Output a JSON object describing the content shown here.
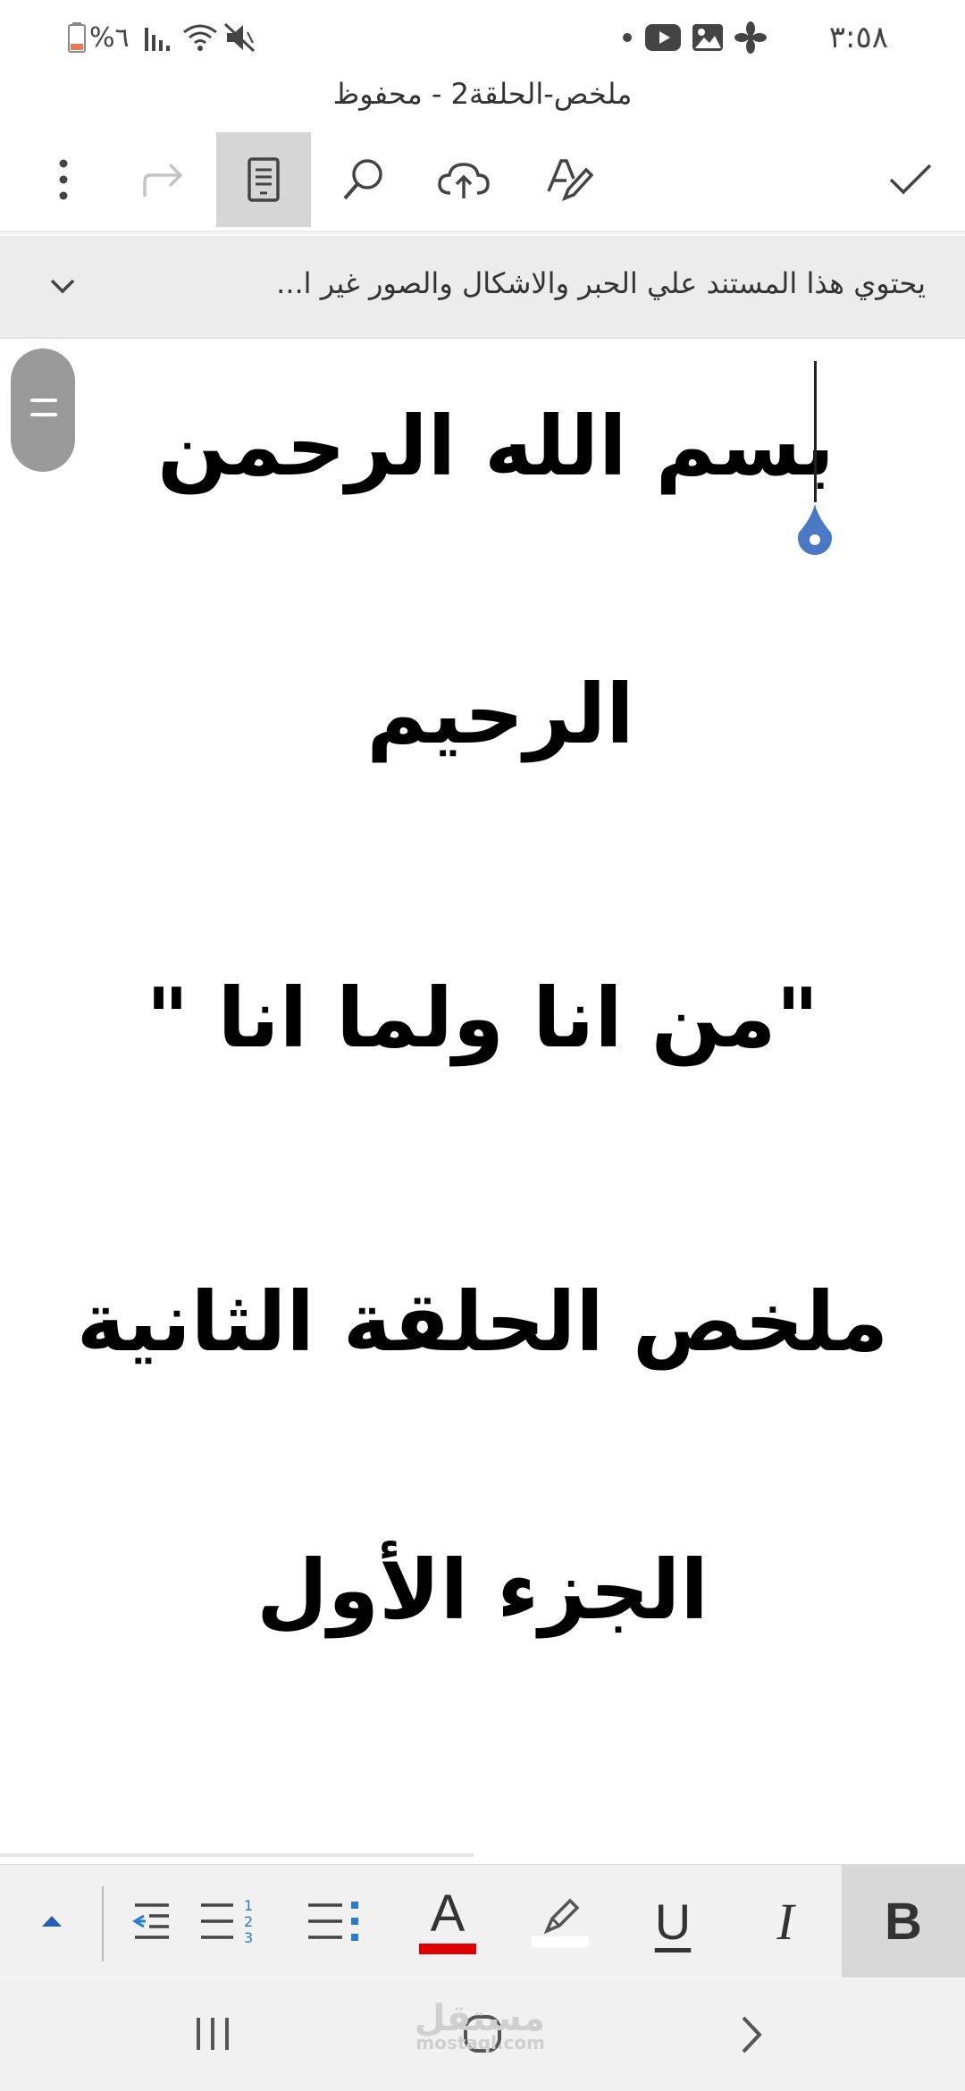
{
  "status_bar": {
    "time": "٣:٥٨",
    "battery": "%٦",
    "icons": [
      "dot-icon",
      "youtube-icon",
      "gallery-icon",
      "fan-icon",
      "mute-icon",
      "wifi-icon",
      "signal-icon",
      "battery-icon"
    ]
  },
  "document": {
    "title": "ملخص-الحلقة2 - محفوظ"
  },
  "toolbar": {
    "buttons": [
      "more-options-icon",
      "redo-icon",
      "mobile-view-icon",
      "search-icon",
      "save-cloud-icon",
      "draw-pen-icon",
      "done-check-icon"
    ],
    "active": "mobile-view-icon"
  },
  "notice": {
    "text": "يحتوي هذا المستند علي الحبر والاشكال والصور غير ا..."
  },
  "content": {
    "lines": [
      "بسم الله الرحمن",
      "الرحيم",
      "\"من انا ولما انا \"",
      "ملخص الحلقة الثانية",
      "الجزء الأول"
    ]
  },
  "format_bar": {
    "bold": "B",
    "italic": "I",
    "underline": "U",
    "font_color_letter": "A",
    "font_color": "#e00000",
    "highlight_color": "#ffffff",
    "list_numbers": "123"
  },
  "nav_bar": {
    "buttons": [
      "recent-apps-icon",
      "home-icon",
      "back-icon"
    ]
  },
  "watermark": {
    "text": "مستقل",
    "sub": "mostaql.com"
  },
  "colors": {
    "accent_blue": "#4a78c4",
    "toolbar_active": "#d6d6d6"
  }
}
